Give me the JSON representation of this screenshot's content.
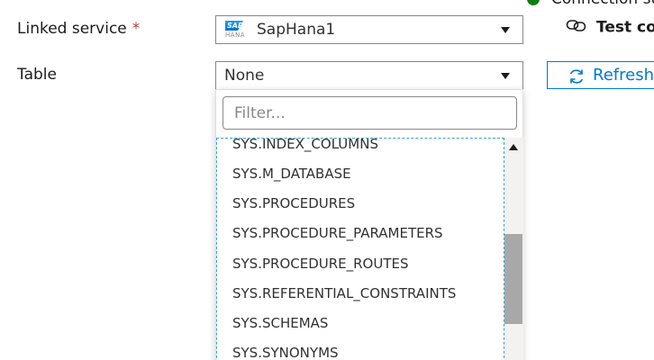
{
  "status": {
    "text": "Connection su"
  },
  "linked_service": {
    "label": "Linked service",
    "required_mark": "*",
    "value": "SapHana1",
    "logo_top": "SAP",
    "logo_bottom": "HANA"
  },
  "test_connection": {
    "label": "Test co"
  },
  "table": {
    "label": "Table",
    "value": "None"
  },
  "refresh": {
    "label": "Refresh"
  },
  "dropdown": {
    "filter_placeholder": "Filter...",
    "items": [
      "SYS.INDEX_COLUMNS",
      "SYS.M_DATABASE",
      "SYS.PROCEDURES",
      "SYS.PROCEDURE_PARAMETERS",
      "SYS.PROCEDURE_ROUTES",
      "SYS.REFERENTIAL_CONSTRAINTS",
      "SYS.SCHEMAS",
      "SYS.SYNONYMS"
    ]
  },
  "colors": {
    "accent": "#0078d4",
    "success": "#107c10",
    "required": "#c0392b"
  }
}
